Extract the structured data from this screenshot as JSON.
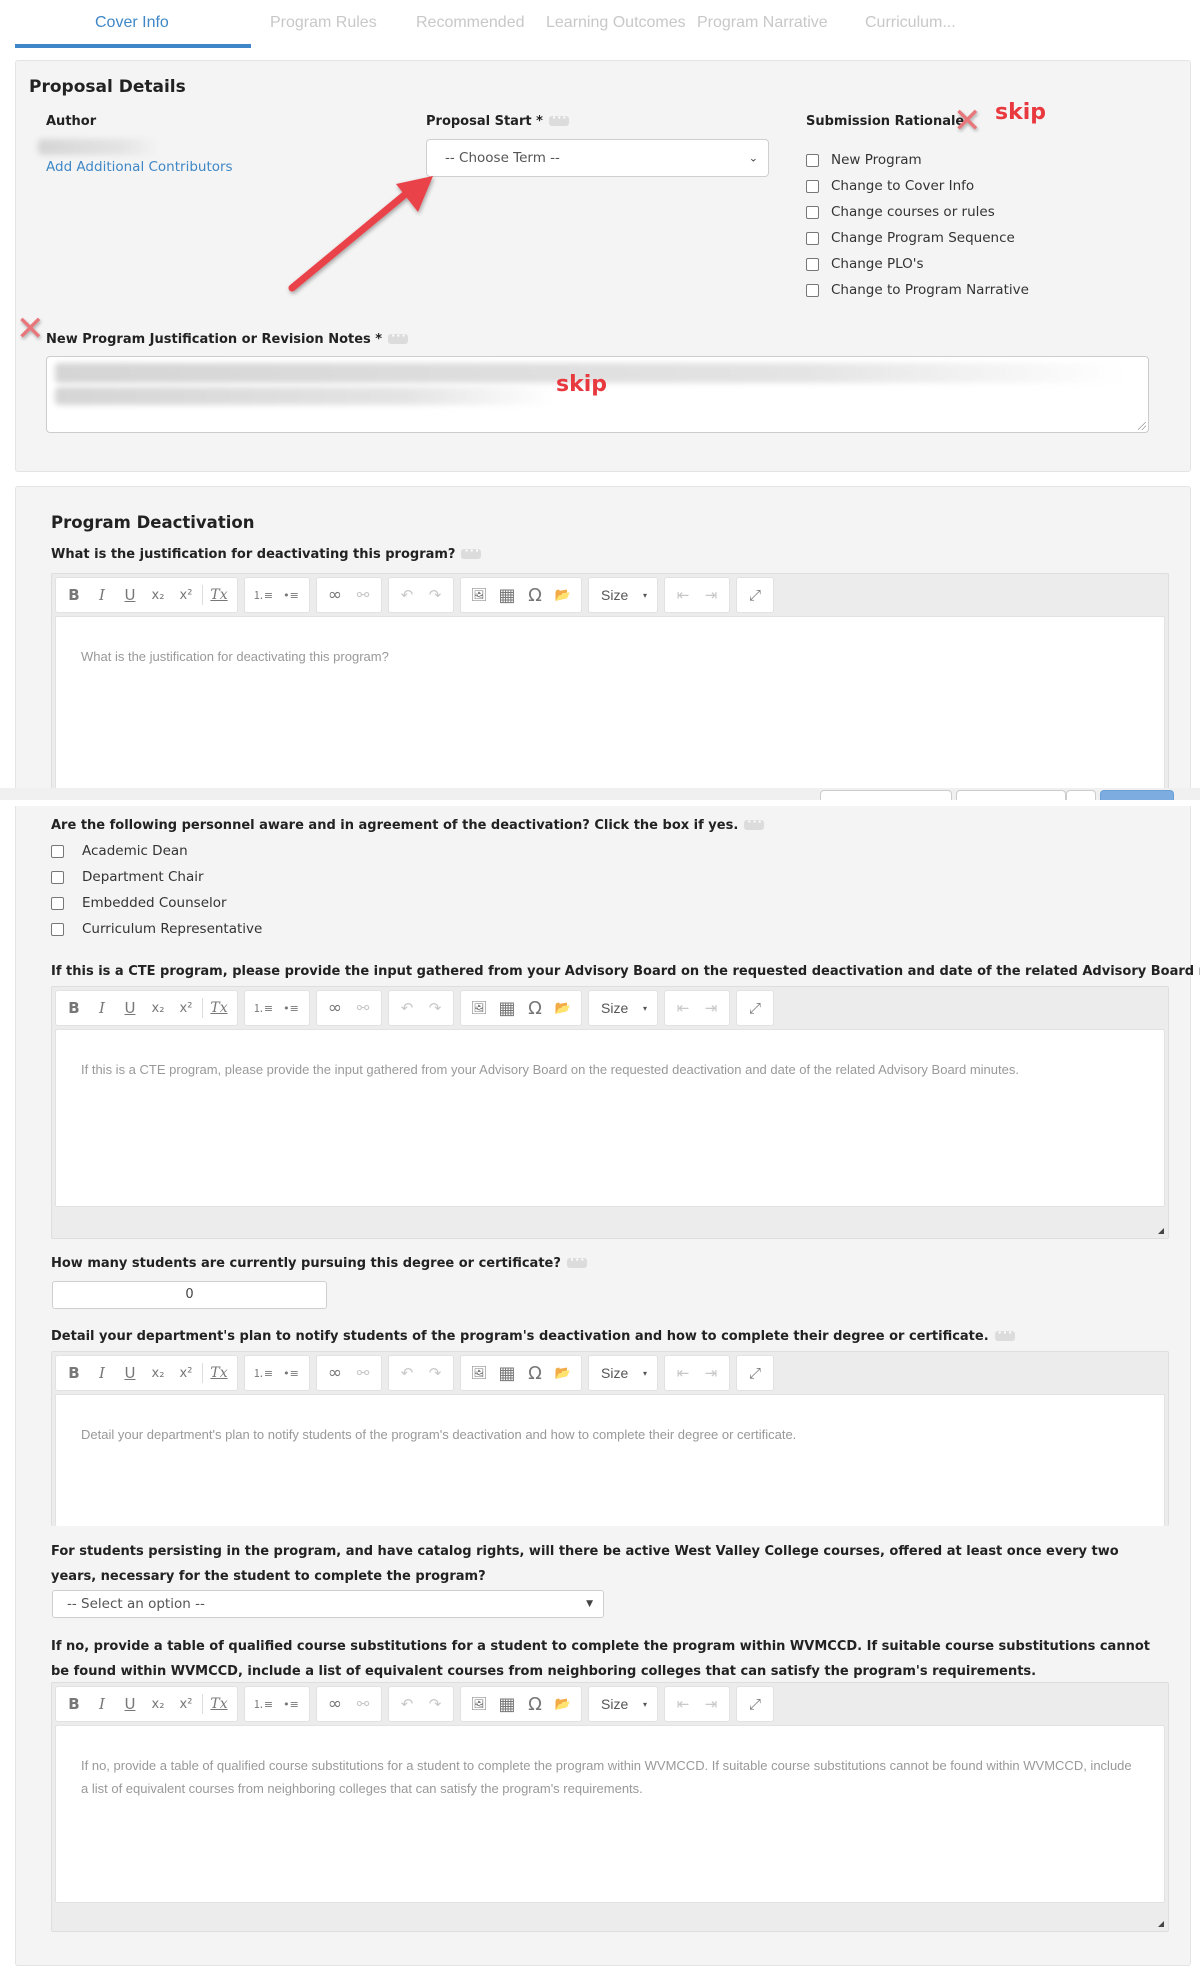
{
  "tabs": [
    {
      "label": "Cover Info",
      "active": true
    },
    {
      "label": "Program Rules",
      "active": false
    },
    {
      "label": "Recommended",
      "active": false
    },
    {
      "label": "Learning Outcomes",
      "active": false
    },
    {
      "label": "Program Narrative",
      "active": false
    },
    {
      "label": "Curriculum...",
      "active": false
    }
  ],
  "proposal_details": {
    "title": "Proposal Details",
    "author_label": "Author",
    "add_contributors_link": "Add Additional Contributors",
    "proposal_start_label": "Proposal Start *",
    "proposal_start_value": "-- Choose Term --",
    "submission_rationale_label": "Submission Rationale",
    "rationale_options": [
      {
        "label": "New Program",
        "checked": false
      },
      {
        "label": "Change to Cover Info",
        "checked": false
      },
      {
        "label": "Change courses or rules",
        "checked": false
      },
      {
        "label": "Change Program Sequence",
        "checked": false
      },
      {
        "label": "Change PLO's",
        "checked": false
      },
      {
        "label": "Change to Program Narrative",
        "checked": false
      }
    ],
    "justification_label": "New Program Justification or Revision Notes *"
  },
  "annotations": {
    "skip_1": "skip",
    "skip_2": "skip",
    "x_mark": "✕",
    "arrow_color": "#e8393f"
  },
  "deactivation": {
    "title": "Program Deactivation",
    "q_justification": "What is the justification for deactivating this program?",
    "q_justification_placeholder": "What is the justification for deactivating this program?",
    "q_personnel": "Are the following personnel aware and in agreement of the deactivation? Click the box if yes.",
    "personnel_options": [
      {
        "label": "Academic Dean",
        "checked": false
      },
      {
        "label": "Department Chair",
        "checked": false
      },
      {
        "label": "Embedded Counselor",
        "checked": false
      },
      {
        "label": "Curriculum Representative",
        "checked": false
      }
    ],
    "q_cte": "If this is a CTE program, please provide the input gathered from your Advisory Board on the requested deactivation and date of the related Advisory Board minutes.",
    "q_cte_placeholder": "If this is a CTE program, please provide the input gathered from your Advisory Board on the requested deactivation and date of the related Advisory Board minutes.",
    "q_students": "How many students are currently pursuing this degree or certificate?",
    "students_value": "0",
    "q_plan": "Detail your department's plan to notify students of the program's deactivation and how to complete their degree or certificate.",
    "q_plan_placeholder": "Detail your department's plan to notify students of the program's deactivation and how to complete their degree or certificate.",
    "q_persisting": "For students persisting in the program, and have catalog rights, will there be active West Valley College courses, offered at least once every two years, necessary for the student to complete the program?",
    "persisting_value": "-- Select an option --",
    "q_substitutions": "If no, provide a table of qualified course substitutions for a student to complete the program within WVMCCD. If suitable course substitutions cannot be found within WVMCCD, include a list of equivalent courses from neighboring colleges that can satisfy the program's requirements.",
    "q_substitutions_placeholder": "If no, provide a table of qualified course substitutions for a student to complete the program within WVMCCD. If suitable course substitutions cannot be found within WVMCCD, include a list of equivalent courses from neighboring colleges that can satisfy the program's requirements."
  },
  "editor_toolbar": {
    "bold": "B",
    "italic": "I",
    "underline": "U",
    "subscript": "x₂",
    "superscript": "x²",
    "remove_format": "Tx",
    "numbered_list": "⒈≡",
    "bulleted_list": "•≡",
    "link": "∞",
    "unlink": "⚯",
    "undo": "↶",
    "redo": "↷",
    "image": "🖼",
    "table": "▦",
    "special_char": "Ω",
    "browse": "📂",
    "size_label": "Size",
    "size_caret": "▾",
    "outdent": "⇤",
    "indent": "⇥",
    "maximize": "⤢"
  },
  "colors": {
    "accent": "#3f87c6",
    "annotation_red": "#e8393f",
    "panel_bg": "#f4f4f4"
  }
}
